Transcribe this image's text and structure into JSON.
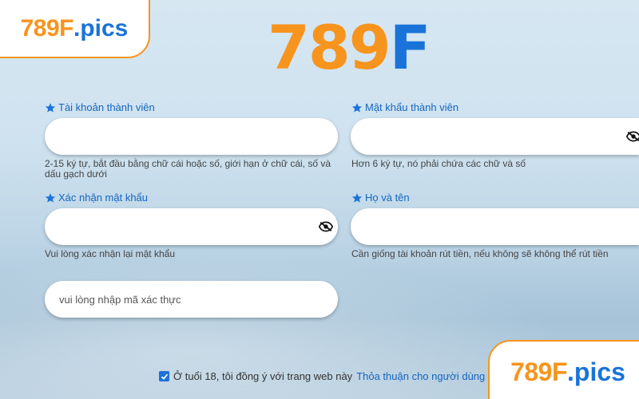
{
  "brand": {
    "main_logo_digits": "789",
    "main_logo_letter": "F",
    "watermark_digits": "789F",
    "watermark_ext": ".pics",
    "accent_orange": "#f7941d",
    "accent_blue": "#1a73d9"
  },
  "form": {
    "username": {
      "label": "Tài khoản thành viên",
      "value": "",
      "hint": "2-15 ký tự, bắt đầu bằng chữ cái hoặc số, giới hạn ở chữ cái, số và dấu gạch dưới"
    },
    "password": {
      "label": "Mật khẩu thành viên",
      "value": "",
      "hint": "Hơn 6 ký tự, nó phải chứa các chữ và số"
    },
    "confirm_password": {
      "label": "Xác nhận mật khẩu",
      "value": "",
      "hint": "Vui lòng xác nhận lại mật khẩu"
    },
    "full_name": {
      "label": "Họ và tên",
      "value": "",
      "hint": "Cần giống tài khoản rút tiền, nếu không sẽ không thể rút tiền"
    },
    "captcha": {
      "placeholder": "vui lòng nhập mã xác thực"
    }
  },
  "agreement": {
    "checked": true,
    "text": "Ở tuổi 18, tôi đồng ý với trang web này",
    "link": "Thỏa thuận cho người dùng"
  }
}
